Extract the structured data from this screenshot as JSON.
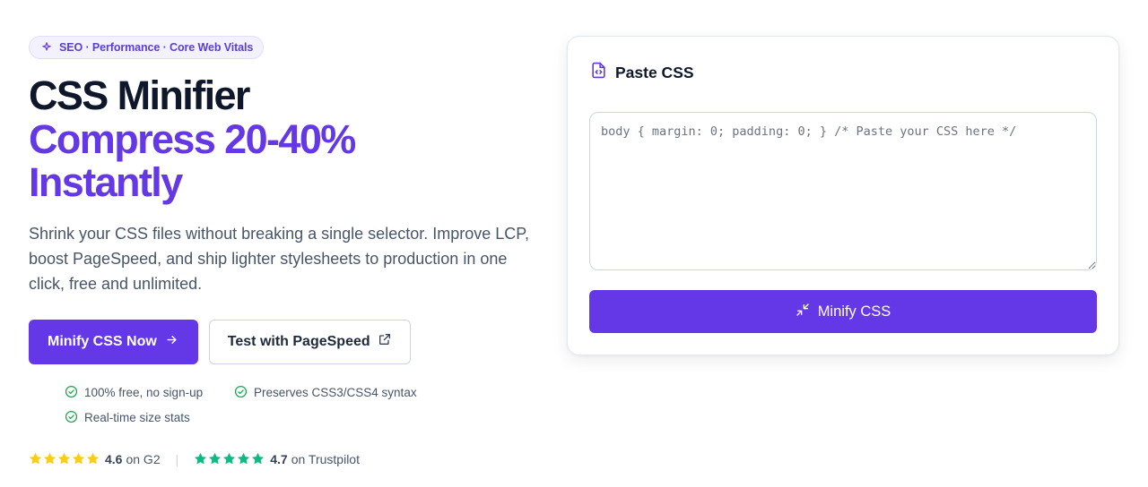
{
  "badge": {
    "text": "SEO · Performance · Core Web Vitals",
    "icon": "sparkles-icon"
  },
  "hero": {
    "title_line1": "CSS Minifier",
    "title_line2": "Compress 20-40%",
    "title_line3": "Instantly",
    "description": "Shrink your CSS files without breaking a single selector. Improve LCP, boost PageSpeed, and ship lighter stylesheets to production in one click, free and unlimited."
  },
  "cta": {
    "primary_label": "Minify CSS Now",
    "primary_icon": "arrow-right-icon",
    "secondary_label": "Test with PageSpeed",
    "secondary_icon": "external-link-icon"
  },
  "features": [
    {
      "text": "100% free, no sign-up"
    },
    {
      "text": "Preserves CSS3/CSS4 syntax"
    },
    {
      "text": "Real-time size stats"
    }
  ],
  "ratings": [
    {
      "stars": 5,
      "score": "4.6",
      "platform": "on G2",
      "star_color": "#facc15"
    },
    {
      "stars": 5,
      "score": "4.7",
      "platform": "on Trustpilot",
      "star_color": "#10b981"
    }
  ],
  "rating_separator": "|",
  "card": {
    "title": "Paste CSS",
    "title_icon": "file-code-icon",
    "input_value": "",
    "input_placeholder": "body { margin: 0; padding: 0; } /* Paste your CSS here */",
    "button_label": "Minify CSS",
    "button_icon": "minimize-icon"
  },
  "colors": {
    "accent": "#6438e6",
    "heading": "#0f172a",
    "body_text": "#475569",
    "check": "#16a34a"
  }
}
